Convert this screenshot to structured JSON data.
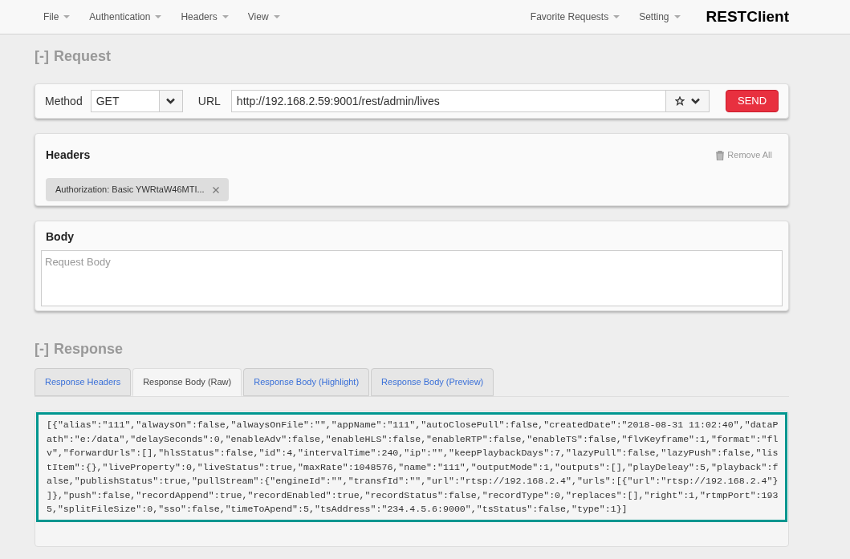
{
  "navbar": {
    "left_menus": [
      {
        "label": "File"
      },
      {
        "label": "Authentication"
      },
      {
        "label": "Headers"
      },
      {
        "label": "View"
      }
    ],
    "right_menus": [
      {
        "label": "Favorite Requests"
      },
      {
        "label": "Setting"
      }
    ],
    "brand": "RESTClient"
  },
  "request": {
    "toggle": "[-]",
    "title": "Request",
    "method_label": "Method",
    "method": "GET",
    "url_label": "URL",
    "url": "http://192.168.2.59:9001/rest/admin/lives",
    "send": "SEND"
  },
  "headers": {
    "title": "Headers",
    "remove_all": "Remove All",
    "items": [
      {
        "label": "Authorization: Basic YWRtaW46MTI..."
      }
    ]
  },
  "body": {
    "title": "Body",
    "placeholder": "Request Body"
  },
  "response": {
    "toggle": "[-]",
    "title": "Response",
    "tabs": [
      {
        "label": "Response Headers",
        "selected": false
      },
      {
        "label": "Response Body (Raw)",
        "selected": true
      },
      {
        "label": "Response Body (Highlight)",
        "selected": false
      },
      {
        "label": "Response Body (Preview)",
        "selected": false
      }
    ],
    "body_lines": [
      "[{\"alias\":\"111\",\"alwaysOn\":false,\"alwaysOnFile\":\"\",\"appName\":\"111\",\"autoClosePull\":false,\"createdDate\":\"2018-08-31 11:02:40\",\"dataP",
      "ath\":\"e:/data\",\"delaySeconds\":0,\"enableAdv\":false,\"enableHLS\":false,\"enableRTP\":false,\"enableTS\":false,\"flvKeyframe\":1,\"format\":\"fl",
      "v\",\"forwardUrls\":[],\"hlsStatus\":false,\"id\":4,\"intervalTime\":240,\"ip\":\"\",\"keepPlaybackDays\":7,\"lazyPull\":false,\"lazyPush\":false,\"lis",
      "tItem\":{},\"liveProperty\":0,\"liveStatus\":true,\"maxRate\":1048576,\"name\":\"111\",\"outputMode\":1,\"outputs\":[],\"playDeleay\":5,\"playback\":f",
      "alse,\"publishStatus\":true,\"pullStream\":{\"engineId\":\"\",\"transfId\":\"\",\"url\":\"rtsp://192.168.2.4\",\"urls\":[{\"url\":\"rtsp://192.168.2.4\"}",
      "]},\"push\":false,\"recordAppend\":true,\"recordEnabled\":true,\"recordStatus\":false,\"recordType\":0,\"replaces\":[],\"right\":1,\"rtmpPort\":193",
      "5,\"splitFileSize\":0,\"sso\":false,\"timeToApend\":5,\"tsAddress\":\"234.4.5.6:9000\",\"tsStatus\":false,\"type\":1}]"
    ]
  }
}
